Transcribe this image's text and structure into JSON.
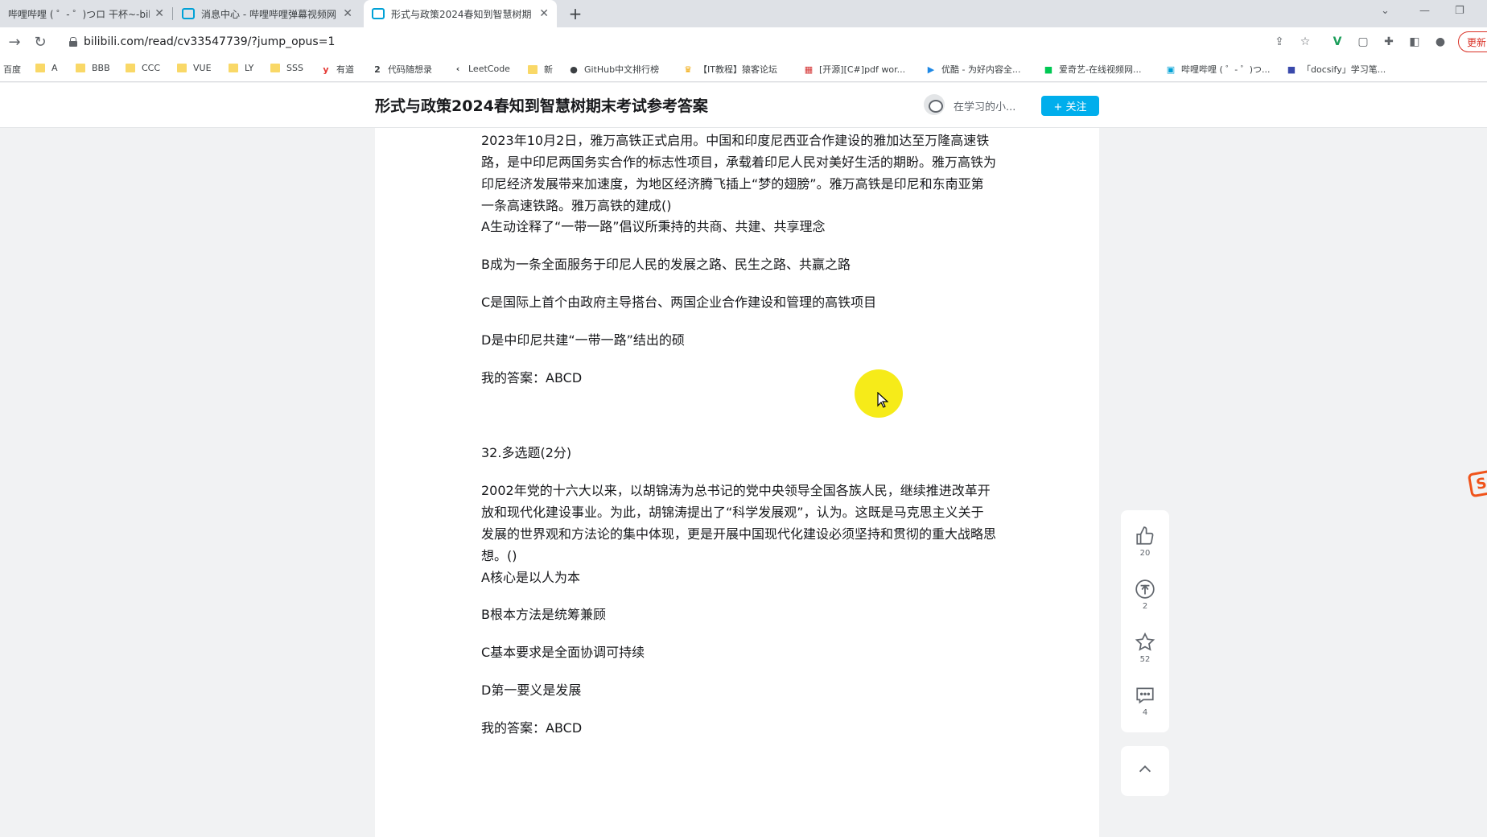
{
  "browser": {
    "tabs": [
      {
        "title": "哔哩哔哩 ( ゜- ゜)つロ 干杯~-bili",
        "active": false
      },
      {
        "title": "消息中心 - 哔哩哔哩弹幕视频网",
        "active": false
      },
      {
        "title": "形式与政策2024春知到智慧树期",
        "active": false
      },
      {
        "title": "",
        "active": true
      }
    ],
    "url": "bilibili.com/read/cv33547739/?jump_opus=1",
    "update_label": "更新",
    "bookmarks": [
      "百度",
      "A",
      "BBB",
      "CCC",
      "VUE",
      "LY",
      "SSS",
      "有道",
      "代码随想录",
      "LeetCode",
      "新",
      "GitHub中文排行榜",
      "【IT教程】猿客论坛",
      "[开源][C#]pdf wor...",
      "优酷 - 为好内容全...",
      "爱奇艺-在线视频网...",
      "哔哩哔哩 ( ゜- ゜)つ...",
      "「docsify」学习笔..."
    ]
  },
  "article": {
    "title": "形式与政策2024春知到智慧树期末考试参考答案",
    "author": "在学习的小...",
    "follow_label": "+ 关注"
  },
  "content": {
    "q31_stem": "2023年10月2日，雅万高铁正式启用。中国和印度尼西亚合作建设的雅加达至万隆高速铁路，是中印尼两国务实合作的标志性项目，承载着印尼人民对美好生活的期盼。雅万高铁为印尼经济发展带来加速度，为地区经济腾飞插上“梦的翅膀”。雅万高铁是印尼和东南亚第一条高速铁路。雅万高铁的建成()",
    "q31_a": "A生动诠释了“一带一路”倡议所秉持的共商、共建、共享理念",
    "q31_b": "B成为一条全面服务于印尼人民的发展之路、民生之路、共赢之路",
    "q31_c": "C是国际上首个由政府主导搭台、两国企业合作建设和管理的高铁项目",
    "q31_d": "D是中印尼共建“一带一路”结出的硕",
    "q31_answer": "我的答案：ABCD",
    "q32_header": "32.多选题(2分)",
    "q32_stem": "2002年党的十六大以来，以胡锦涛为总书记的党中央领导全国各族人民，继续推进改革开放和现代化建设事业。为此，胡锦涛提出了“科学发展观”，认为。这既是马克思主义关于发展的世界观和方法论的集中体现，更是开展中国现代化建设必须坚持和贯彻的重大战略思想。()",
    "q32_a": "A核心是以人为本",
    "q32_b": "B根本方法是统筹兼顾",
    "q32_c": "C基本要求是全面协调可持续",
    "q32_d": "D第一要义是发展",
    "q32_answer": "我的答案：ABCD"
  },
  "side_actions": {
    "like_count": "20",
    "coin_count": "2",
    "favorite_count": "52",
    "comment_count": "4"
  }
}
